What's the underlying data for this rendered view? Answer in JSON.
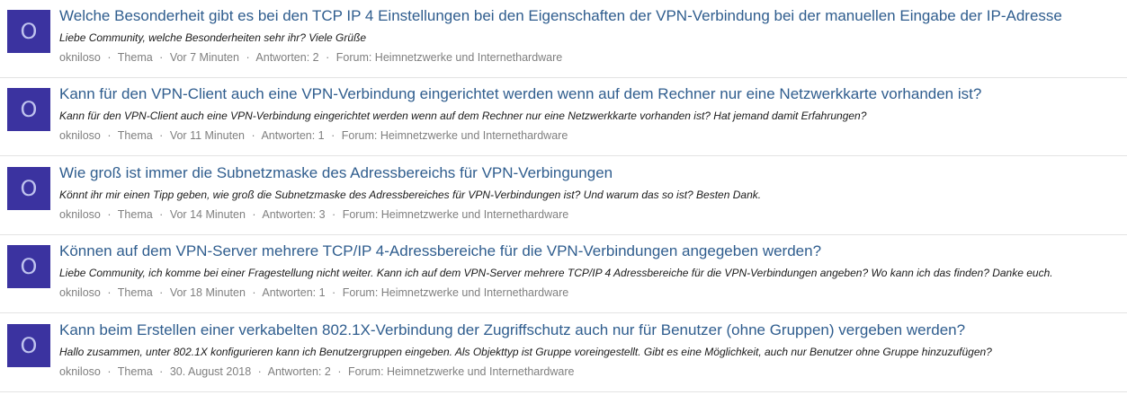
{
  "colors": {
    "avatar_bg": "#3b33a0",
    "avatar_letter": "#bfc3ee",
    "title_link": "#2f5d8e",
    "meta_text": "#7f7f7f",
    "separator": "#e3e3e3"
  },
  "separator": "·",
  "topics": [
    {
      "avatar_letter": "O",
      "title": "Welche Besonderheit gibt es bei den TCP IP 4 Einstellungen bei den Eigenschaften der VPN-Verbindung bei der manuellen Eingabe der IP-Adresse",
      "excerpt": "Liebe Community, welche Besonderheiten sehr ihr? Viele Grüße",
      "author": "okniloso",
      "type": "Thema",
      "time": "Vor 7 Minuten",
      "replies": "Antworten: 2",
      "forum": "Forum: Heimnetzwerke und Internethardware"
    },
    {
      "avatar_letter": "O",
      "title": "Kann für den VPN-Client auch eine VPN-Verbindung eingerichtet werden wenn auf dem Rechner nur eine Netzwerkkarte vorhanden ist?",
      "excerpt": "Kann für den VPN-Client auch eine VPN-Verbindung eingerichtet werden wenn auf dem Rechner nur eine Netzwerkkarte vorhanden ist? Hat jemand damit Erfahrungen?",
      "author": "okniloso",
      "type": "Thema",
      "time": "Vor 11 Minuten",
      "replies": "Antworten: 1",
      "forum": "Forum: Heimnetzwerke und Internethardware"
    },
    {
      "avatar_letter": "O",
      "title": "Wie groß ist immer die Subnetzmaske des Adressbereichs für VPN-Verbingungen",
      "excerpt": "Könnt ihr mir einen Tipp geben, wie groß die Subnetzmaske des Adressbereiches für VPN-Verbindungen ist? Und warum das so ist? Besten Dank.",
      "author": "okniloso",
      "type": "Thema",
      "time": "Vor 14 Minuten",
      "replies": "Antworten: 3",
      "forum": "Forum: Heimnetzwerke und Internethardware"
    },
    {
      "avatar_letter": "O",
      "title": "Können auf dem VPN-Server mehrere TCP/IP 4-Adressbereiche für die VPN-Verbindungen angegeben werden?",
      "excerpt": "Liebe Community, ich komme bei einer Fragestellung nicht weiter. Kann ich auf dem VPN-Server mehrere TCP/IP 4 Adressbereiche für die VPN-Verbindungen angeben? Wo kann ich das finden? Danke euch.",
      "author": "okniloso",
      "type": "Thema",
      "time": "Vor 18 Minuten",
      "replies": "Antworten: 1",
      "forum": "Forum: Heimnetzwerke und Internethardware"
    },
    {
      "avatar_letter": "O",
      "title": "Kann beim Erstellen einer verkabelten 802.1X-Verbindung der Zugriffschutz auch nur für Benutzer (ohne Gruppen) vergeben werden?",
      "excerpt": "Hallo zusammen, unter 802.1X konfigurieren kann ich Benutzergruppen eingeben. Als Objekttyp ist Gruppe voreingestellt. Gibt es eine Möglichkeit, auch nur Benutzer ohne Gruppe hinzuzufügen?",
      "author": "okniloso",
      "type": "Thema",
      "time": "30. August 2018",
      "replies": "Antworten: 2",
      "forum": "Forum: Heimnetzwerke und Internethardware"
    }
  ]
}
